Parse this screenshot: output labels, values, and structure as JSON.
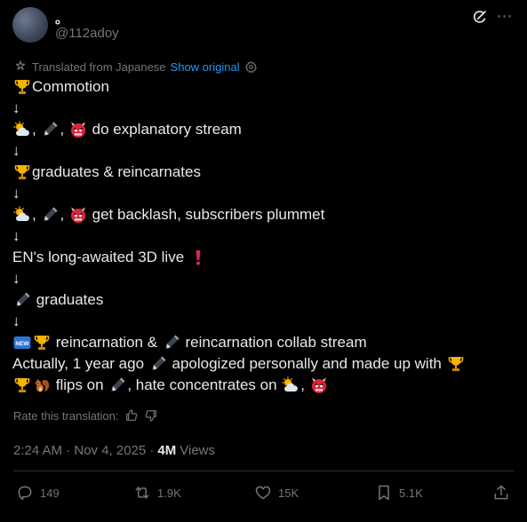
{
  "author": {
    "display_name": "。",
    "handle": "@112adoy"
  },
  "translation": {
    "label": "Translated from Japanese",
    "show_original": "Show original"
  },
  "tweet_lines": [
    [
      {
        "e": "trophy"
      },
      {
        "t": "Commotion"
      }
    ],
    [
      {
        "t": "↓"
      }
    ],
    [
      {
        "e": "sun"
      },
      {
        "t": ", "
      },
      {
        "e": "pen"
      },
      {
        "t": ", "
      },
      {
        "e": "oni"
      },
      {
        "t": " do explanatory stream"
      }
    ],
    [
      {
        "t": "↓"
      }
    ],
    [
      {
        "e": "trophy"
      },
      {
        "t": "graduates & reincarnates"
      }
    ],
    [
      {
        "t": "↓"
      }
    ],
    [
      {
        "e": "sun"
      },
      {
        "t": ", "
      },
      {
        "e": "pen"
      },
      {
        "t": ", "
      },
      {
        "e": "oni"
      },
      {
        "t": " get backlash, subscribers plummet"
      }
    ],
    [
      {
        "t": "↓"
      }
    ],
    [
      {
        "t": "EN's long-awaited 3D live "
      },
      {
        "e": "exclaim"
      }
    ],
    [
      {
        "t": "↓"
      }
    ],
    [
      {
        "e": "pen"
      },
      {
        "t": " graduates"
      }
    ],
    [
      {
        "t": "↓"
      }
    ],
    [
      {
        "e": "new"
      },
      {
        "e": "trophy"
      },
      {
        "t": " reincarnation & "
      },
      {
        "e": "pen"
      },
      {
        "t": " reincarnation collab stream"
      }
    ],
    [
      {
        "t": "Actually, 1 year ago "
      },
      {
        "e": "pen"
      },
      {
        "t": " apologized personally and made up with "
      },
      {
        "e": "trophy"
      }
    ],
    [
      {
        "e": "trophy"
      },
      {
        "e": "squirrel"
      },
      {
        "t": " flips on "
      },
      {
        "e": "pen"
      },
      {
        "t": ", hate concentrates on "
      },
      {
        "e": "sun"
      },
      {
        "t": ", "
      },
      {
        "e": "oni"
      }
    ]
  ],
  "rate": {
    "label": "Rate this translation:"
  },
  "meta": {
    "timestamp": "2:24 AM · Nov 4, 2025 ·",
    "views_count": "4M",
    "views_label": "Views"
  },
  "actions": {
    "reply": "149",
    "retweet": "1.9K",
    "like": "15K",
    "bookmark": "5.1K"
  },
  "colors": {
    "background": "#000000",
    "text": "#e7e9ea",
    "muted": "#71767b",
    "link": "#1d9bf0",
    "divider": "#2f3336"
  }
}
